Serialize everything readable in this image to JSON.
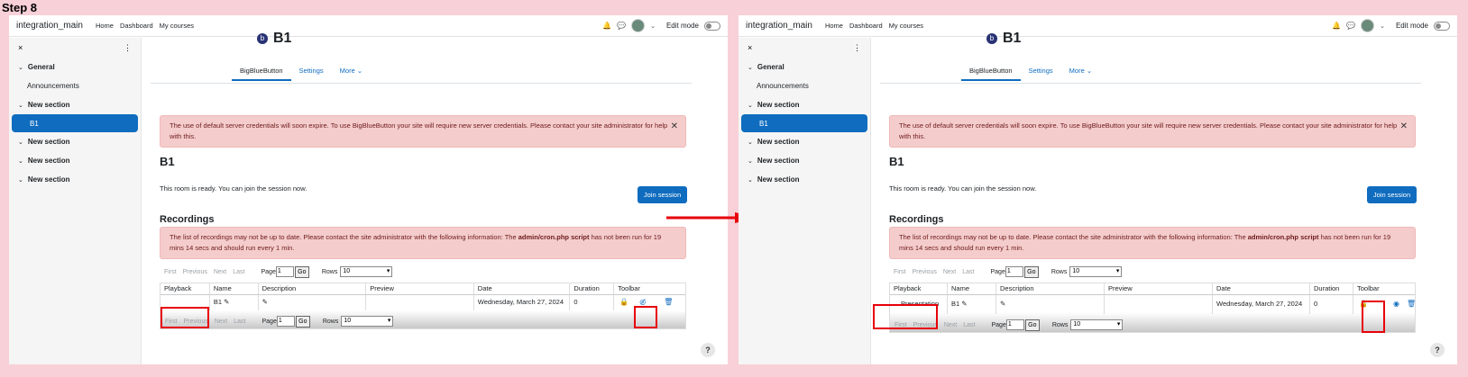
{
  "step_label": "Step 8",
  "colors": {
    "brand": "#0f6cbf",
    "alert_bg": "#f4cccc",
    "highlight": "#e8000a",
    "background": "#f8d0d8"
  },
  "nav": {
    "brand": "integration_main",
    "links": [
      "Home",
      "Dashboard",
      "My courses"
    ],
    "edit_mode": "Edit mode",
    "icons": [
      "bell-icon",
      "chat-icon",
      "avatar",
      "chevron-down-icon"
    ]
  },
  "drawer": {
    "close": "×",
    "menu": "⋮",
    "items": [
      {
        "label": "General",
        "type": "section"
      },
      {
        "label": "Announcements",
        "type": "sub"
      },
      {
        "label": "New section",
        "type": "section"
      },
      {
        "label": "B1",
        "type": "active"
      },
      {
        "label": "New section",
        "type": "section"
      },
      {
        "label": "New section",
        "type": "section"
      },
      {
        "label": "New section",
        "type": "section"
      }
    ]
  },
  "main": {
    "title": "B1",
    "tabs": [
      "BigBlueButton",
      "Settings",
      "More"
    ],
    "alert_credentials": "The use of default server credentials will soon expire. To use BigBlueButton your site will require new server credentials. Please contact your site administrator for help with this.",
    "room_title": "B1",
    "ready_text": "This room is ready. You can join the session now.",
    "join_button": "Join session",
    "recordings_title": "Recordings",
    "alert_cron_prefix": "The list of recordings may not be up to date. Please contact the site administrator with the following information: The ",
    "alert_cron_bold": "admin/cron.php script",
    "alert_cron_suffix": " has not been run for 19 mins 14 secs and should run every 1 min.",
    "pager": {
      "first": "First",
      "previous": "Previous",
      "next": "Next",
      "last": "Last",
      "page_label": "Page",
      "page_value": "1",
      "go": "Go",
      "rows_label": "Rows",
      "rows_value": "10"
    },
    "columns": [
      "Playback",
      "Name",
      "Description",
      "Preview",
      "Date",
      "Duration",
      "Toolbar"
    ],
    "row": {
      "name": "B1",
      "date": "Wednesday, March 27, 2024",
      "duration": "0"
    },
    "playback_before": "",
    "playback_after": "Presentation",
    "help": "?"
  }
}
